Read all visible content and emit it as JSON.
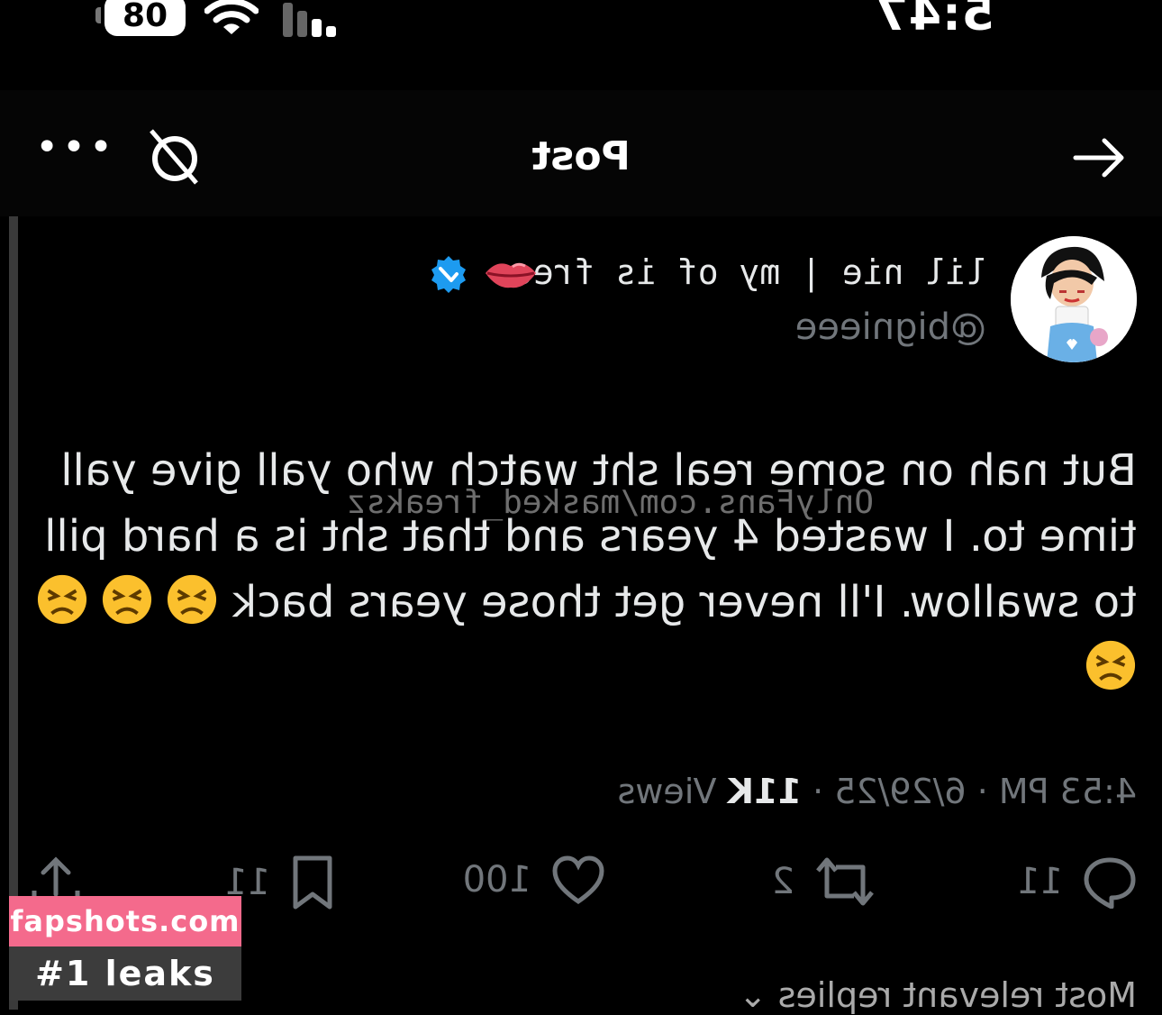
{
  "status_bar": {
    "time": "5:47",
    "battery": "08"
  },
  "header": {
    "title": "Post"
  },
  "post": {
    "display_name": "lil nie | my of is free",
    "handle": "@bignieee",
    "text": "But nah on some real sht watch who yall give yall time to. I wasted 4 years and that sht is a hard pill to swallow. I'll never get those years back",
    "watermark": "OnlyFans.com/masked_freaksz",
    "timestamp": "4:53 PM · 6/29/25 · ",
    "views_count": "11K",
    "views_label": " Views"
  },
  "actions": {
    "replies": "11",
    "reposts": "2",
    "likes": "100",
    "bookmarks": "11"
  },
  "replies_filter": "Most relevant replies",
  "badge": {
    "site": "fapshots.com",
    "tagline": "#1 leaks"
  },
  "colors": {
    "verified": "#1d9bf0",
    "badge_pink": "#f46a8c",
    "badge_gray": "#3c3c3c"
  }
}
